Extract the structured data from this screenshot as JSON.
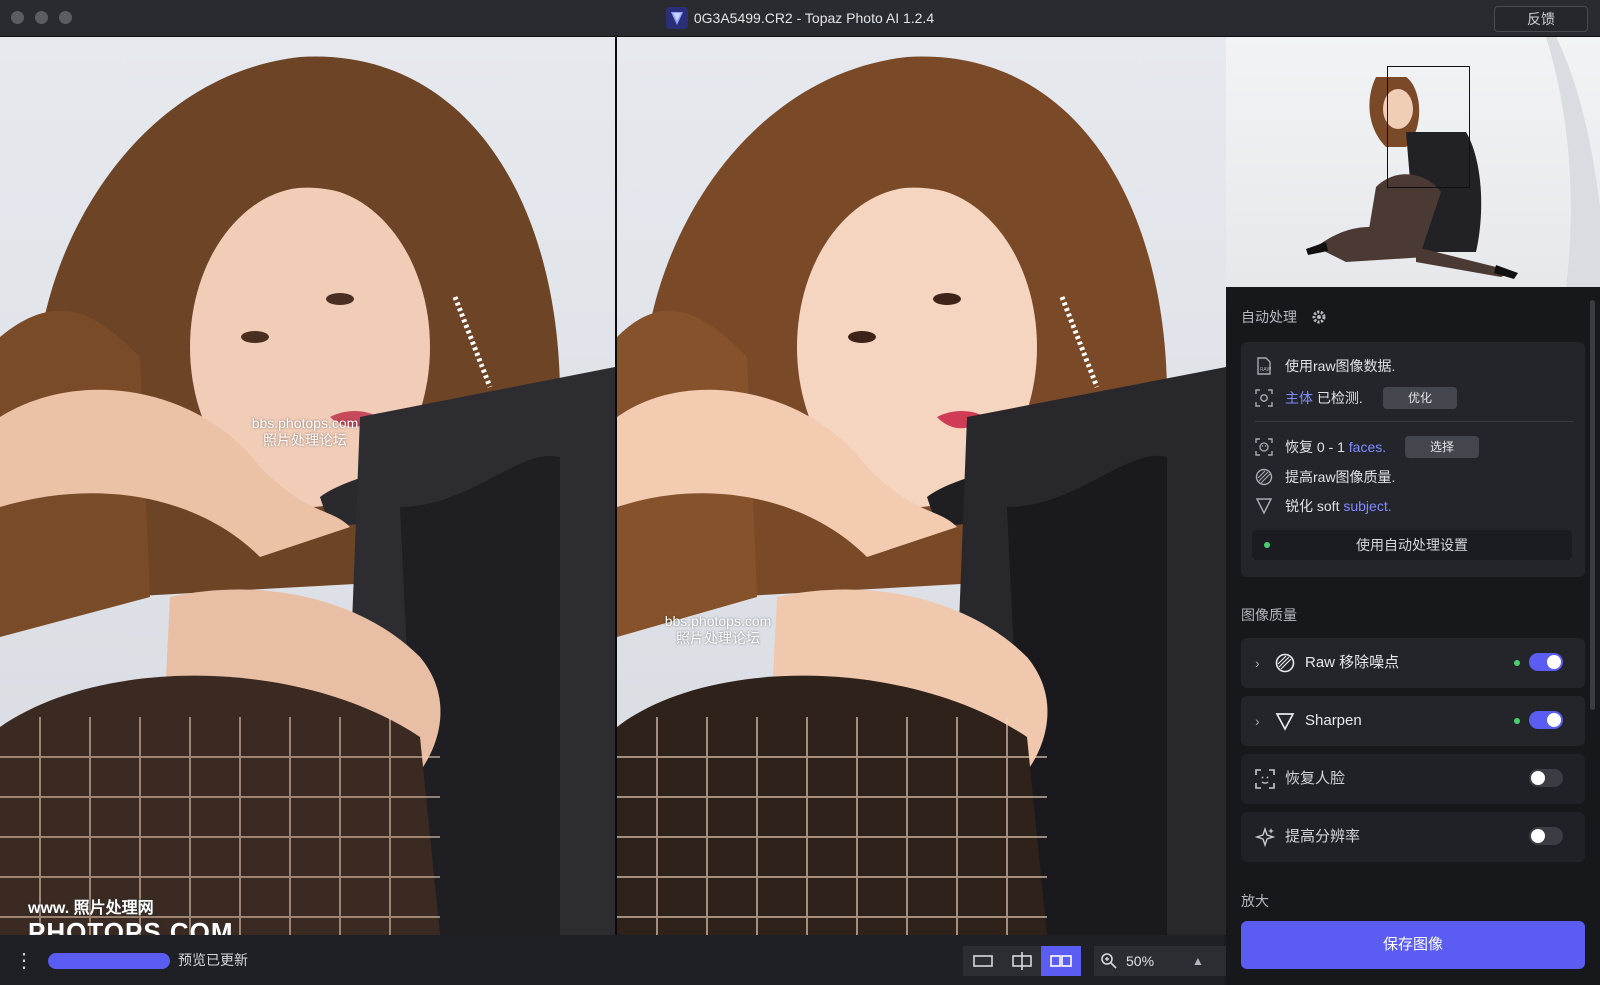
{
  "window": {
    "title": "0G3A5499.CR2 - Topaz Photo AI 1.2.4",
    "feedback_label": "反馈"
  },
  "viewer": {
    "watermark_left_line1": "bbs.photops.com",
    "watermark_left_line2": "照片处理论坛",
    "watermark_right_line1": "bbs.photops.com",
    "watermark_right_line2": "照片处理论坛",
    "corner_watermark_line1": "www.  照片处理网",
    "corner_watermark_line2": "PHOTOPS.COM"
  },
  "statusbar": {
    "menu_icon": "more-vertical-icon",
    "preview_progress": 1.0,
    "status_text": "预览已更新",
    "view_modes": [
      "single",
      "split",
      "side-by-side"
    ],
    "active_view_mode": "side-by-side",
    "zoom_value": "50%"
  },
  "autopilot": {
    "section_title": "自动处理",
    "items": {
      "raw": "使用raw图像数据.",
      "subject_hl": "主体",
      "subject_rest": "已检测.",
      "subject_button": "优化",
      "faces_prefix": "恢复 0 - 1",
      "faces_hl": "faces.",
      "faces_button": "选择",
      "raw_quality": "提高raw图像质量.",
      "sharpen_prefix": "锐化 soft",
      "sharpen_hl": "subject."
    },
    "apply_label": "使用自动处理设置"
  },
  "image_quality": {
    "section_title": "图像质量",
    "filters": [
      {
        "name": "Raw 移除噪点",
        "enabled": true
      },
      {
        "name": "Sharpen",
        "enabled": true
      },
      {
        "name": "恢复人脸",
        "enabled": false
      },
      {
        "name": "提高分辨率",
        "enabled": false
      }
    ]
  },
  "upscale": {
    "section_title": "放大"
  },
  "save_label": "保存图像",
  "colors": {
    "accent": "#5a5cf2",
    "active_dot": "#46d16c",
    "link": "#7f8cff"
  }
}
